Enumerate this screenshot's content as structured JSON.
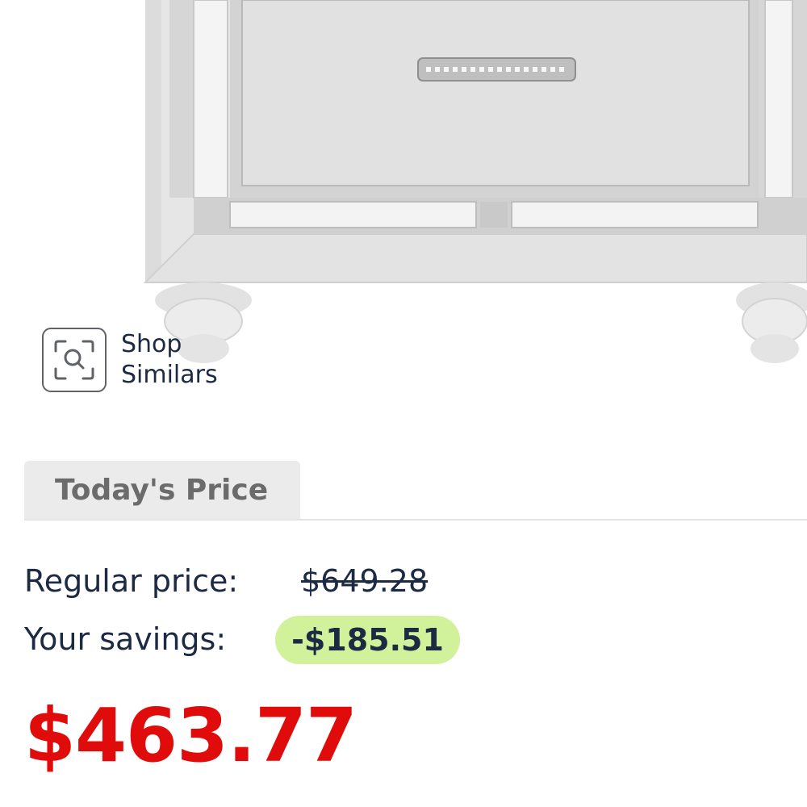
{
  "shop_similars": {
    "label": "Shop Similars"
  },
  "price_tab": {
    "label": "Today's Price"
  },
  "pricing": {
    "regular_label": "Regular price:",
    "regular_value": "$649.28",
    "savings_label": "Your savings:",
    "savings_value": "-$185.51",
    "final_price": "$463.77"
  },
  "colors": {
    "final_price": "#e00b0b",
    "savings_badge_bg": "#d2f19b",
    "text": "#1c2a44"
  },
  "icons": {
    "shop_similars": "visual-search-icon"
  }
}
